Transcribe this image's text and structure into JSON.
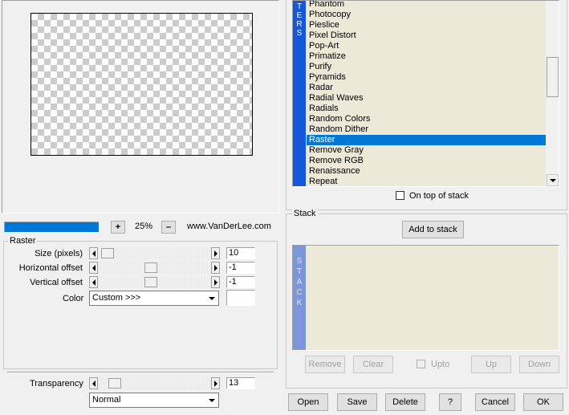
{
  "filters_list": {
    "side_label": "TERS",
    "items": [
      "Phantom",
      "Photocopy",
      "Pieslice",
      "Pixel Distort",
      "Pop-Art",
      "Primatize",
      "Purify",
      "Pyramids",
      "Radar",
      "Radial Waves",
      "Radials",
      "Random Colors",
      "Random Dither",
      "Raster",
      "Remove Gray",
      "Remove RGB",
      "Renaissance",
      "Repeat"
    ],
    "selected": "Raster"
  },
  "on_top_of_stack": {
    "label": "On top of stack",
    "checked": false
  },
  "zoom": {
    "plus": "+",
    "minus": "–",
    "value": "25%",
    "website": "www.VanDerLee.com",
    "progress": 1.0
  },
  "raster_group": {
    "title": "Raster",
    "params": [
      {
        "label": "Size (pixels)",
        "value": "10",
        "fraction": 0.03
      },
      {
        "label": "Horizontal offset",
        "value": "-1",
        "fraction": 0.46
      },
      {
        "label": "Vertical offset",
        "value": "-1",
        "fraction": 0.46
      }
    ],
    "color_label": "Color",
    "color_value": "Custom >>>",
    "color_swatch": "#ffffff"
  },
  "transparency": {
    "label": "Transparency",
    "value": "13",
    "fraction": 0.1
  },
  "blend_mode": "Normal",
  "stack": {
    "title": "Stack",
    "add_button": "Add to stack",
    "side_label": "STACK",
    "remove": "Remove",
    "clear": "Clear",
    "upto": "Upto",
    "up": "Up",
    "down": "Down"
  },
  "bottom_buttons": {
    "open": "Open",
    "save": "Save",
    "delete": "Delete",
    "help": "?",
    "cancel": "Cancel",
    "ok": "OK"
  },
  "colors": {
    "accent_blue": "#0078d7",
    "side_blue": "#1457d9",
    "stack_side": "#7c96d8",
    "list_bg": "#ece9d8"
  }
}
